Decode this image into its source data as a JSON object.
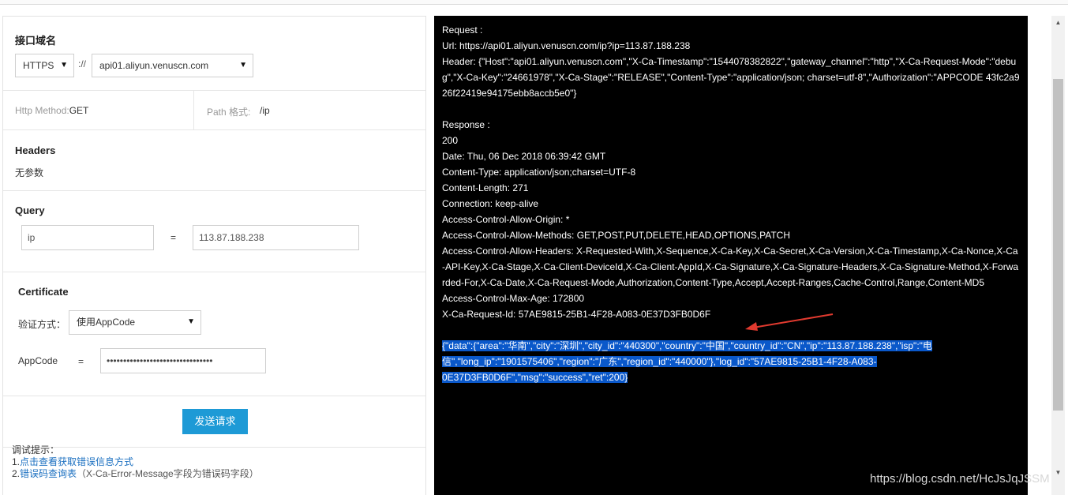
{
  "left": {
    "domain": {
      "title": "接口域名",
      "scheme": "HTTPS",
      "separator": "://",
      "host": "api01.aliyun.venuscn.com"
    },
    "method": {
      "label": "Http Method:",
      "value": "GET",
      "path_label": "Path 格式:",
      "path_value": "/ip"
    },
    "headers": {
      "title": "Headers",
      "empty": "无参数"
    },
    "query": {
      "title": "Query",
      "key": "ip",
      "equals": "=",
      "value": "113.87.188.238"
    },
    "certificate": {
      "title": "Certificate",
      "auth_label": "验证方式：",
      "auth_value": "使用AppCode",
      "appcode_label": "AppCode",
      "equals": "=",
      "appcode_value": "••••••••••••••••••••••••••••••••"
    },
    "send_label": "发送请求",
    "tips": {
      "title": "调试提示：",
      "item1_prefix": "1.",
      "item1_link": "点击查看获取错误信息方式",
      "item2_prefix": "2.",
      "item2_link": "错误码查询表",
      "item2_suffix": "（X-Ca-Error-Message字段为错误码字段）"
    }
  },
  "console": {
    "request_title": "Request :",
    "url": "Url: https://api01.aliyun.venuscn.com/ip?ip=113.87.188.238",
    "header": "Header: {\"Host\":\"api01.aliyun.venuscn.com\",\"X-Ca-Timestamp\":\"1544078382822\",\"gateway_channel\":\"http\",\"X-Ca-Request-Mode\":\"debug\",\"X-Ca-Key\":\"24661978\",\"X-Ca-Stage\":\"RELEASE\",\"Content-Type\":\"application/json; charset=utf-8\",\"Authorization\":\"APPCODE 43fc2a926f22419e94175ebb8accb5e0\"}",
    "response_title": "Response :",
    "status": "200",
    "date": "Date: Thu, 06 Dec 2018 06:39:42 GMT",
    "content_type": "Content-Type: application/json;charset=UTF-8",
    "content_length": "Content-Length: 271",
    "connection": "Connection: keep-alive",
    "acao": "Access-Control-Allow-Origin: *",
    "acam": "Access-Control-Allow-Methods: GET,POST,PUT,DELETE,HEAD,OPTIONS,PATCH",
    "acah": "Access-Control-Allow-Headers: X-Requested-With,X-Sequence,X-Ca-Key,X-Ca-Secret,X-Ca-Version,X-Ca-Timestamp,X-Ca-Nonce,X-Ca-API-Key,X-Ca-Stage,X-Ca-Client-DeviceId,X-Ca-Client-AppId,X-Ca-Signature,X-Ca-Signature-Headers,X-Ca-Signature-Method,X-Forwarded-For,X-Ca-Date,X-Ca-Request-Mode,Authorization,Content-Type,Accept,Accept-Ranges,Cache-Control,Range,Content-MD5",
    "acma": "Access-Control-Max-Age: 172800",
    "request_id": "X-Ca-Request-Id: 57AE9815-25B1-4F28-A083-0E37D3FB0D6F",
    "body_line1": "{\"data\":{\"area\":\"华南\",\"city\":\"深圳\",\"city_id\":\"440300\",\"country\":\"中国\",\"country_id\":\"CN\",\"ip\":\"113.87.188.238\",\"isp\":\"电",
    "body_line2": "信\",\"long_ip\":\"1901575406\",\"region\":\"广东\",\"region_id\":\"440000\"},\"log_id\":\"57AE9815-25B1-4F28-A083-",
    "body_line3": "0E37D3FB0D6F\",\"msg\":\"success\",\"ret\":200}"
  },
  "watermark": "https://blog.csdn.net/HcJsJqJSSM",
  "colors": {
    "console_bg": "#000000",
    "selection": "#0a58ca",
    "button": "#1e9ad6",
    "arrow": "#e03a2f",
    "link": "#1a6fc0"
  }
}
